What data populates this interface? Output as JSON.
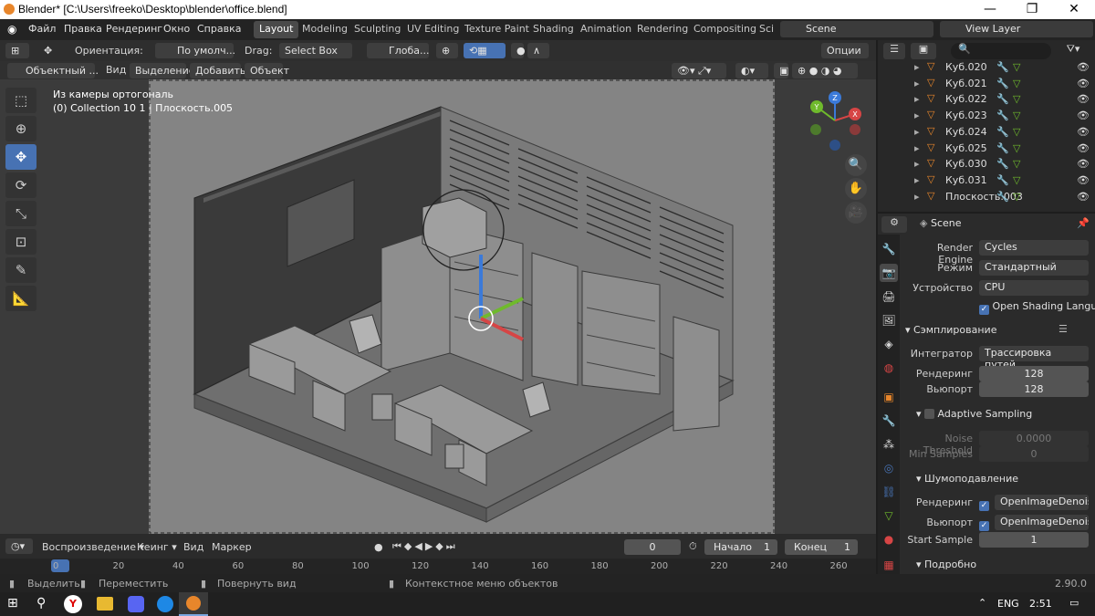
{
  "window": {
    "title": "Blender* [C:\\Users\\freeko\\Desktop\\blender\\office.blend]"
  },
  "menu": [
    "Файл",
    "Правка",
    "Рендеринг",
    "Окно",
    "Справка"
  ],
  "workspaces": [
    "Layout",
    "Modeling",
    "Sculpting",
    "UV Editing",
    "Texture Paint",
    "Shading",
    "Animation",
    "Rendering",
    "Compositing",
    "Sci"
  ],
  "scene": "Scene",
  "view_layer": "View Layer",
  "viewport_header": {
    "orientation_label": "Ориентация:",
    "orientation_value": "По умолч...",
    "drag_label": "Drag:",
    "drag_value": "Select Box",
    "transform": "Глоба...",
    "options": "Опции"
  },
  "viewport_header2": {
    "mode": "Объектный ...",
    "view": "Вид",
    "select": "Выделение",
    "add": "Добавить",
    "object": "Объект"
  },
  "viewport": {
    "camera_text": "Из камеры ортогональ",
    "collection_text": "(0) Collection 10 1 | Плоскость.005",
    "gizmo": {
      "z": "Z",
      "x": "X",
      "y": "Y"
    }
  },
  "outliner": {
    "search_placeholder": "",
    "items": [
      "Куб.020",
      "Куб.021",
      "Куб.022",
      "Куб.023",
      "Куб.024",
      "Куб.025",
      "Куб.030",
      "Куб.031",
      "Плоскость.003"
    ]
  },
  "properties": {
    "context": "Scene",
    "render_engine_label": "Render Engine",
    "render_engine": "Cycles",
    "mode_label": "Режим",
    "mode": "Стандартный",
    "device_label": "Устройство",
    "device": "CPU",
    "osl": "Open Shading Langua...",
    "sampling": "Сэмплирование",
    "integrator_label": "Интегратор",
    "integrator": "Трассировка путей",
    "render_label": "Рендеринг",
    "render_samples": "128",
    "viewport_label": "Вьюпорт",
    "viewport_samples": "128",
    "adaptive": "Adaptive Sampling",
    "noise_label": "Noise Threshold",
    "noise_value": "0.0000",
    "min_label": "Min Samples",
    "min_value": "0",
    "denoise": "Шумоподавление",
    "denoise_render_label": "Рендеринг",
    "denoise_render": "OpenImageDenoise",
    "denoise_viewport_label": "Вьюпорт",
    "denoise_viewport": "OpenImageDenoise",
    "start_sample_label": "Start Sample",
    "start_sample": "1",
    "details": "Подробно"
  },
  "timeline": {
    "playback": "Воспроизведение",
    "keying": "Кеинг",
    "view": "Вид",
    "marker": "Маркер",
    "current_frame": "0",
    "start_label": "Начало",
    "start": "1",
    "end_label": "Конец",
    "end": "1",
    "ticks": [
      "0",
      "20",
      "40",
      "60",
      "80",
      "100",
      "120",
      "140",
      "160",
      "180",
      "200",
      "220",
      "240",
      "260"
    ]
  },
  "statusbar": {
    "select": "Выделить",
    "move": "Переместить",
    "rotate": "Повернуть вид",
    "context": "Контекстное меню объектов",
    "version": "2.90.0"
  },
  "taskbar": {
    "lang": "ENG",
    "time": "2:51"
  },
  "colors": {
    "accent": "#4772b3",
    "orange": "#e8862b",
    "green": "#6fba2c"
  }
}
